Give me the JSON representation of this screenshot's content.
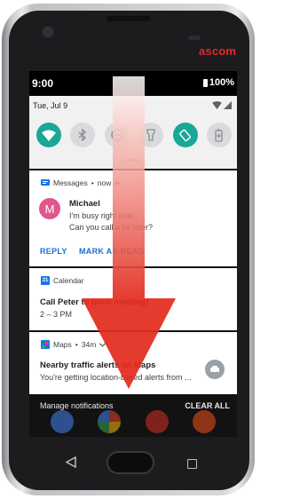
{
  "device": {
    "brand": "ascom"
  },
  "status_bar": {
    "time": "9:00",
    "battery": "100%"
  },
  "quick_settings": {
    "date": "Tue, Jul 9",
    "tiles": [
      {
        "name": "wifi",
        "state": "on"
      },
      {
        "name": "bluetooth",
        "state": "off"
      },
      {
        "name": "do-not-disturb",
        "state": "off"
      },
      {
        "name": "flashlight",
        "state": "off"
      },
      {
        "name": "auto-rotate",
        "state": "on"
      },
      {
        "name": "battery-saver",
        "state": "off"
      }
    ],
    "colors": {
      "on": "#1aa797",
      "off": "#d9dadc"
    }
  },
  "notifications": {
    "messages": {
      "app": "Messages",
      "sep": "•",
      "time": "now",
      "sender": "Michael",
      "avatar_letter": "M",
      "line1": "I'm busy right now.",
      "line2": "Can you call a bit later?",
      "actions": {
        "reply": "REPLY",
        "mark_read": "MARK AS READ"
      }
    },
    "calendar": {
      "app": "Calendar",
      "icon_number": "31",
      "title": "Call Peter to book meeting!",
      "time": "2 – 3 PM"
    },
    "maps": {
      "app": "Maps",
      "sep": "•",
      "age": "34m",
      "title": "Nearby traffic alerts on Maps",
      "body": "You're getting location-based alerts from ..."
    }
  },
  "shade_footer": {
    "manage": "Manage notifications",
    "clear_all": "CLEAR ALL"
  },
  "accent": "#1f6fd1",
  "overlay": {
    "color": "#e32b1e"
  }
}
